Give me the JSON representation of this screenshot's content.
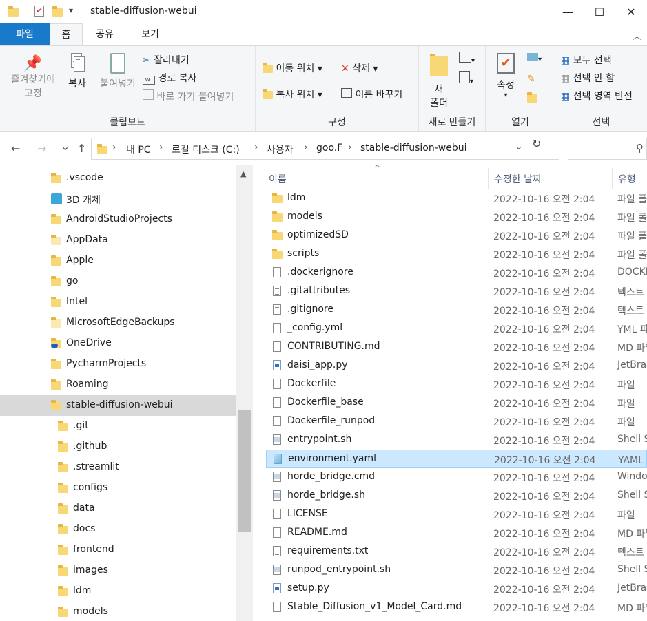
{
  "window": {
    "title": "stable-diffusion-webui",
    "min_glyph": "—",
    "max_glyph": "☐",
    "close_glyph": "✕",
    "qat_dropdown": "▾"
  },
  "ribbon_tabs": [
    "파일",
    "홈",
    "공유",
    "보기"
  ],
  "ribbon_collapse": "︿",
  "ribbon": {
    "clipboard": {
      "title": "클립보드",
      "pin_line1": "즐겨찾기에",
      "pin_line2": "고정",
      "copy": "복사",
      "paste": "붙여넣기",
      "cut": "잘라내기",
      "copy_path": "경로 복사",
      "paste_shortcut": "바로 가기 붙여넣기"
    },
    "organize": {
      "title": "구성",
      "move_to": "이동 위치",
      "delete": "삭제",
      "copy_to": "복사 위치",
      "rename": "이름 바꾸기"
    },
    "new": {
      "title": "새로 만들기",
      "new_folder_line1": "새",
      "new_folder_line2": "폴더"
    },
    "open": {
      "title": "열기",
      "properties": "속성"
    },
    "select": {
      "title": "선택",
      "select_all": "모두 선택",
      "select_none": "선택 안 함",
      "invert": "선택 영역 반전"
    }
  },
  "address": {
    "back": "←",
    "forward": "→",
    "recent": "⌄",
    "up": "↑",
    "crumbs": [
      "내 PC",
      "로컬 디스크 (C:)",
      "사용자",
      "goo.F",
      "stable-diffusion-webui"
    ],
    "sep": "›",
    "dropdown": "⌄",
    "refresh": "↻",
    "search_icon": "⚲"
  },
  "nav": {
    "scroll_up": "▲",
    "items": [
      {
        "label": ".vscode",
        "icon": "folder-icon",
        "indent": 0
      },
      {
        "label": "3D 개체",
        "icon": "3d-objects-icon",
        "indent": 0
      },
      {
        "label": "AndroidStudioProjects",
        "icon": "folder-icon",
        "indent": 0
      },
      {
        "label": "AppData",
        "icon": "folder-icon",
        "indent": 0
      },
      {
        "label": "Apple",
        "icon": "folder-icon",
        "indent": 0
      },
      {
        "label": "go",
        "icon": "folder-icon",
        "indent": 0
      },
      {
        "label": "Intel",
        "icon": "folder-icon",
        "indent": 0
      },
      {
        "label": "MicrosoftEdgeBackups",
        "icon": "folder-icon",
        "indent": 0
      },
      {
        "label": "OneDrive",
        "icon": "onedrive-icon",
        "indent": 0
      },
      {
        "label": "PycharmProjects",
        "icon": "folder-icon",
        "indent": 0
      },
      {
        "label": "Roaming",
        "icon": "folder-icon",
        "indent": 0
      },
      {
        "label": "stable-diffusion-webui",
        "icon": "folder-icon",
        "indent": 0,
        "selected": true
      },
      {
        "label": ".git",
        "icon": "folder-icon",
        "indent": 1
      },
      {
        "label": ".github",
        "icon": "folder-icon",
        "indent": 1
      },
      {
        "label": ".streamlit",
        "icon": "folder-icon",
        "indent": 1
      },
      {
        "label": "configs",
        "icon": "folder-icon",
        "indent": 1
      },
      {
        "label": "data",
        "icon": "folder-icon",
        "indent": 1
      },
      {
        "label": "docs",
        "icon": "folder-icon",
        "indent": 1
      },
      {
        "label": "frontend",
        "icon": "folder-icon",
        "indent": 1
      },
      {
        "label": "images",
        "icon": "folder-icon",
        "indent": 1
      },
      {
        "label": "ldm",
        "icon": "folder-icon",
        "indent": 1
      },
      {
        "label": "models",
        "icon": "folder-icon",
        "indent": 1
      }
    ]
  },
  "columns": {
    "name": "이름",
    "date": "수정한 날짜",
    "type": "유형",
    "sort_arrow": "^"
  },
  "files": [
    {
      "name": "ldm",
      "date": "2022-10-16 오전 2:04",
      "type": "파일 폴더",
      "icon": "folder"
    },
    {
      "name": "models",
      "date": "2022-10-16 오전 2:04",
      "type": "파일 폴더",
      "icon": "folder"
    },
    {
      "name": "optimizedSD",
      "date": "2022-10-16 오전 2:04",
      "type": "파일 폴더",
      "icon": "folder"
    },
    {
      "name": "scripts",
      "date": "2022-10-16 오전 2:04",
      "type": "파일 폴더",
      "icon": "folder"
    },
    {
      "name": ".dockerignore",
      "date": "2022-10-16 오전 2:04",
      "type": "DOCKERIGNORE",
      "icon": "doc"
    },
    {
      "name": ".gitattributes",
      "date": "2022-10-16 오전 2:04",
      "type": "텍스트 문서",
      "icon": "doc-lines"
    },
    {
      "name": ".gitignore",
      "date": "2022-10-16 오전 2:04",
      "type": "텍스트 문서",
      "icon": "doc-lines"
    },
    {
      "name": "_config.yml",
      "date": "2022-10-16 오전 2:04",
      "type": "YML 파일",
      "icon": "doc"
    },
    {
      "name": "CONTRIBUTING.md",
      "date": "2022-10-16 오전 2:04",
      "type": "MD 파일",
      "icon": "doc"
    },
    {
      "name": "daisi_app.py",
      "date": "2022-10-16 오전 2:04",
      "type": "JetBrains",
      "icon": "doc-blue"
    },
    {
      "name": "Dockerfile",
      "date": "2022-10-16 오전 2:04",
      "type": "파일",
      "icon": "doc"
    },
    {
      "name": "Dockerfile_base",
      "date": "2022-10-16 오전 2:04",
      "type": "파일",
      "icon": "doc"
    },
    {
      "name": "Dockerfile_runpod",
      "date": "2022-10-16 오전 2:04",
      "type": "파일",
      "icon": "doc"
    },
    {
      "name": "entrypoint.sh",
      "date": "2022-10-16 오전 2:04",
      "type": "Shell Script",
      "icon": "doc-script"
    },
    {
      "name": "environment.yaml",
      "date": "2022-10-16 오전 2:04",
      "type": "YAML 파일",
      "icon": "doc-yaml",
      "selected": true
    },
    {
      "name": "horde_bridge.cmd",
      "date": "2022-10-16 오전 2:04",
      "type": "Windows",
      "icon": "doc-script"
    },
    {
      "name": "horde_bridge.sh",
      "date": "2022-10-16 오전 2:04",
      "type": "Shell Script",
      "icon": "doc-script"
    },
    {
      "name": "LICENSE",
      "date": "2022-10-16 오전 2:04",
      "type": "파일",
      "icon": "doc"
    },
    {
      "name": "README.md",
      "date": "2022-10-16 오전 2:04",
      "type": "MD 파일",
      "icon": "doc"
    },
    {
      "name": "requirements.txt",
      "date": "2022-10-16 오전 2:04",
      "type": "텍스트 문서",
      "icon": "doc-lines"
    },
    {
      "name": "runpod_entrypoint.sh",
      "date": "2022-10-16 오전 2:04",
      "type": "Shell Script",
      "icon": "doc-script"
    },
    {
      "name": "setup.py",
      "date": "2022-10-16 오전 2:04",
      "type": "JetBrains",
      "icon": "doc-blue"
    },
    {
      "name": "Stable_Diffusion_v1_Model_Card.md",
      "date": "2022-10-16 오전 2:04",
      "type": "MD 파일",
      "icon": "doc"
    }
  ]
}
